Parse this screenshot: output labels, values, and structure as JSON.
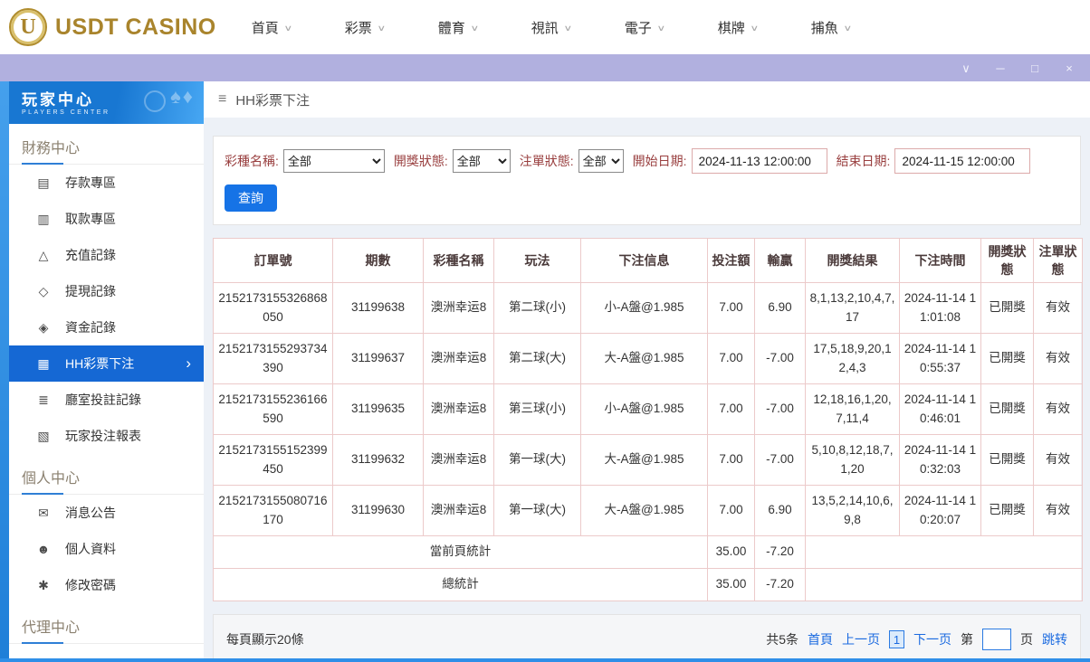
{
  "icons": {
    "chevron_down": "∨",
    "chevron_right": "›",
    "menu": "≡"
  },
  "header": {
    "logo": {
      "badge_letter": "U",
      "text": "USDT CASINO"
    },
    "nav": [
      {
        "name": "home",
        "label": "首頁"
      },
      {
        "name": "lottery",
        "label": "彩票"
      },
      {
        "name": "sports",
        "label": "體育"
      },
      {
        "name": "live",
        "label": "視訊"
      },
      {
        "name": "slots",
        "label": "電子"
      },
      {
        "name": "chess",
        "label": "棋牌"
      },
      {
        "name": "fishing",
        "label": "捕魚"
      }
    ]
  },
  "titlebar": {
    "controls": [
      {
        "name": "collapse-icon",
        "glyph": "∨"
      },
      {
        "name": "minimize-icon",
        "glyph": "─"
      },
      {
        "name": "maximize-icon",
        "glyph": "□"
      },
      {
        "name": "close-icon",
        "glyph": "×"
      }
    ]
  },
  "sidebar": {
    "hero": {
      "title": "玩家中心",
      "subtitle": "PLAYERS CENTER",
      "deco": "♠♦"
    },
    "sections": [
      {
        "name": "finance",
        "title": "財務中心",
        "items": [
          {
            "name": "deposit-area",
            "label": "存款專區",
            "icon": "deposit-icon",
            "glyph": "▤"
          },
          {
            "name": "withdraw-area",
            "label": "取款專區",
            "icon": "withdraw-icon",
            "glyph": "▥"
          },
          {
            "name": "recharge-record",
            "label": "充值記錄",
            "icon": "recharge-record-icon",
            "glyph": "△"
          },
          {
            "name": "withdrawal-record",
            "label": "提現記錄",
            "icon": "withdrawal-record-icon",
            "glyph": "◇"
          },
          {
            "name": "funds-record",
            "label": "資金記錄",
            "icon": "funds-record-icon",
            "glyph": "◈"
          },
          {
            "name": "hh-lottery-bets",
            "label": "HH彩票下注",
            "icon": "lottery-bets-icon",
            "glyph": "▦",
            "active": true
          },
          {
            "name": "room-bet-record",
            "label": "廳室投註記錄",
            "icon": "room-bets-icon",
            "glyph": "≣"
          },
          {
            "name": "player-bet-report",
            "label": "玩家投注報表",
            "icon": "report-icon",
            "glyph": "▧"
          }
        ]
      },
      {
        "name": "personal",
        "title": "個人中心",
        "items": [
          {
            "name": "announcements",
            "label": "消息公告",
            "icon": "announcement-icon",
            "glyph": "✉"
          },
          {
            "name": "profile",
            "label": "個人資料",
            "icon": "profile-icon",
            "glyph": "☻"
          },
          {
            "name": "change-password",
            "label": "修改密碼",
            "icon": "password-icon",
            "glyph": "✱"
          }
        ]
      },
      {
        "name": "agent",
        "title": "代理中心",
        "items": []
      }
    ]
  },
  "breadcrumb": {
    "title": "HH彩票下注"
  },
  "filters": {
    "lottery_label": "彩種名稱:",
    "lottery_value": "全部",
    "draw_status_label": "開獎狀態:",
    "draw_status_value": "全部",
    "order_status_label": "注單狀態:",
    "order_status_value": "全部",
    "start_label": "開始日期:",
    "start_value": "2024-11-13 12:00:00",
    "end_label": "結束日期:",
    "end_value": "2024-11-15 12:00:00",
    "search_button": "查詢"
  },
  "table": {
    "headers": [
      "訂單號",
      "期數",
      "彩種名稱",
      "玩法",
      "下注信息",
      "投注額",
      "輸贏",
      "開獎結果",
      "下注時間",
      "開獎狀態",
      "注單狀態"
    ],
    "rows": [
      [
        "2152173155326868050",
        "31199638",
        "澳洲幸运8",
        "第二球(小)",
        "小-A盤@1.985",
        "7.00",
        "6.90",
        "8,1,13,2,10,4,7,17",
        "2024-11-14 11:01:08",
        "已開獎",
        "有效"
      ],
      [
        "2152173155293734390",
        "31199637",
        "澳洲幸运8",
        "第二球(大)",
        "大-A盤@1.985",
        "7.00",
        "-7.00",
        "17,5,18,9,20,12,4,3",
        "2024-11-14 10:55:37",
        "已開獎",
        "有效"
      ],
      [
        "2152173155236166590",
        "31199635",
        "澳洲幸运8",
        "第三球(小)",
        "小-A盤@1.985",
        "7.00",
        "-7.00",
        "12,18,16,1,20,7,11,4",
        "2024-11-14 10:46:01",
        "已開獎",
        "有效"
      ],
      [
        "2152173155152399450",
        "31199632",
        "澳洲幸运8",
        "第一球(大)",
        "大-A盤@1.985",
        "7.00",
        "-7.00",
        "5,10,8,12,18,7,1,20",
        "2024-11-14 10:32:03",
        "已開獎",
        "有效"
      ],
      [
        "2152173155080716170",
        "31199630",
        "澳洲幸运8",
        "第一球(大)",
        "大-A盤@1.985",
        "7.00",
        "6.90",
        "13,5,2,14,10,6,9,8",
        "2024-11-14 10:20:07",
        "已開獎",
        "有效"
      ]
    ],
    "summary": [
      {
        "label": "當前頁統計",
        "bet": "35.00",
        "winloss": "-7.20"
      },
      {
        "label": "總統計",
        "bet": "35.00",
        "winloss": "-7.20"
      }
    ]
  },
  "pagination": {
    "page_size_text": "每頁顯示20條",
    "total_text": "共5条",
    "first": "首頁",
    "prev": "上一页",
    "current": "1",
    "next": "下一页",
    "jump_prefix": "第",
    "jump_suffix": "页",
    "jump_button": "跳转"
  },
  "colors": {
    "accent_blue": "#1568d4",
    "lavender": "#b1b0df",
    "gold": "#a9842c",
    "table_border": "#eccaca",
    "link_blue": "#1a6ae0"
  }
}
